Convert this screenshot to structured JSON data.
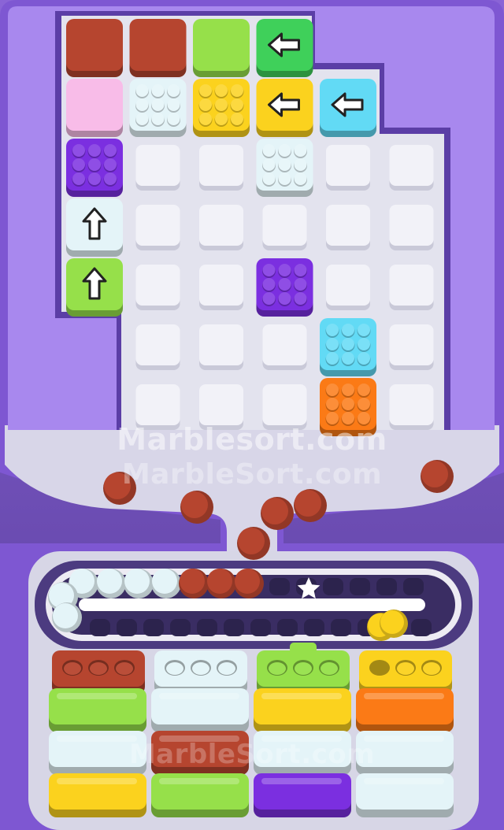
{
  "watermarks": {
    "primary": "Marblesort.com",
    "secondary": "MarbleSort.com",
    "faint": "MarbleSort.com"
  },
  "colors": {
    "red": "#b6452f",
    "white": "#e4f4f8",
    "green": "#96e04a",
    "arrow_green": "#3fd05a",
    "yellow": "#fbd21e",
    "pink": "#f8bce8",
    "purple": "#7b2fe0",
    "cyan": "#62daf5",
    "orange": "#fb7a16"
  },
  "board": {
    "rows": 7,
    "cols": 6,
    "tiles": [
      {
        "row": 0,
        "col": 0,
        "type": "block",
        "color": "red"
      },
      {
        "row": 0,
        "col": 1,
        "type": "block",
        "color": "red"
      },
      {
        "row": 0,
        "col": 2,
        "type": "block",
        "color": "green"
      },
      {
        "row": 0,
        "col": 3,
        "type": "arrow",
        "color": "arrow_green",
        "dir": "left"
      },
      {
        "row": 1,
        "col": 0,
        "type": "block",
        "color": "pink"
      },
      {
        "row": 1,
        "col": 1,
        "type": "marble",
        "color": "white"
      },
      {
        "row": 1,
        "col": 2,
        "type": "marble",
        "color": "yellow"
      },
      {
        "row": 1,
        "col": 3,
        "type": "arrow",
        "color": "yellow",
        "dir": "left"
      },
      {
        "row": 1,
        "col": 4,
        "type": "arrow",
        "color": "cyan",
        "dir": "left"
      },
      {
        "row": 2,
        "col": 0,
        "type": "marble",
        "color": "purple"
      },
      {
        "row": 2,
        "col": 3,
        "type": "marble",
        "color": "white"
      },
      {
        "row": 3,
        "col": 0,
        "type": "arrow",
        "color": "white",
        "dir": "up"
      },
      {
        "row": 4,
        "col": 0,
        "type": "arrow",
        "color": "green",
        "dir": "up"
      },
      {
        "row": 4,
        "col": 3,
        "type": "marble",
        "color": "purple"
      },
      {
        "row": 5,
        "col": 4,
        "type": "marble",
        "color": "cyan"
      },
      {
        "row": 6,
        "col": 4,
        "type": "marble",
        "color": "orange"
      }
    ]
  },
  "falling_marbles": [
    {
      "color": "red"
    },
    {
      "color": "red"
    },
    {
      "color": "red"
    },
    {
      "color": "red"
    },
    {
      "color": "red"
    },
    {
      "color": "red"
    }
  ],
  "conveyor": {
    "top_lane": [
      "white",
      "white",
      "white",
      "white",
      "red",
      "red",
      "red"
    ],
    "left_bend": [
      "white",
      "white"
    ],
    "right_bend": [
      "yellow",
      "yellow"
    ],
    "star_icon": "star-icon"
  },
  "slots": [
    {
      "color": "red",
      "marbles": [
        "red",
        "red",
        "red"
      ]
    },
    {
      "color": "white",
      "marbles": [
        "white",
        "white",
        "white"
      ]
    },
    {
      "color": "green",
      "marbles": [
        "green",
        "green",
        "green"
      ]
    },
    {
      "color": "yellow",
      "marbles": [
        "empty",
        "yellow",
        "yellow"
      ]
    }
  ],
  "queue": [
    [
      "green",
      "white",
      "yellow",
      "orange"
    ],
    [
      "white",
      "red",
      "white",
      "white"
    ],
    [
      "yellow",
      "green",
      "purple",
      "white"
    ]
  ]
}
